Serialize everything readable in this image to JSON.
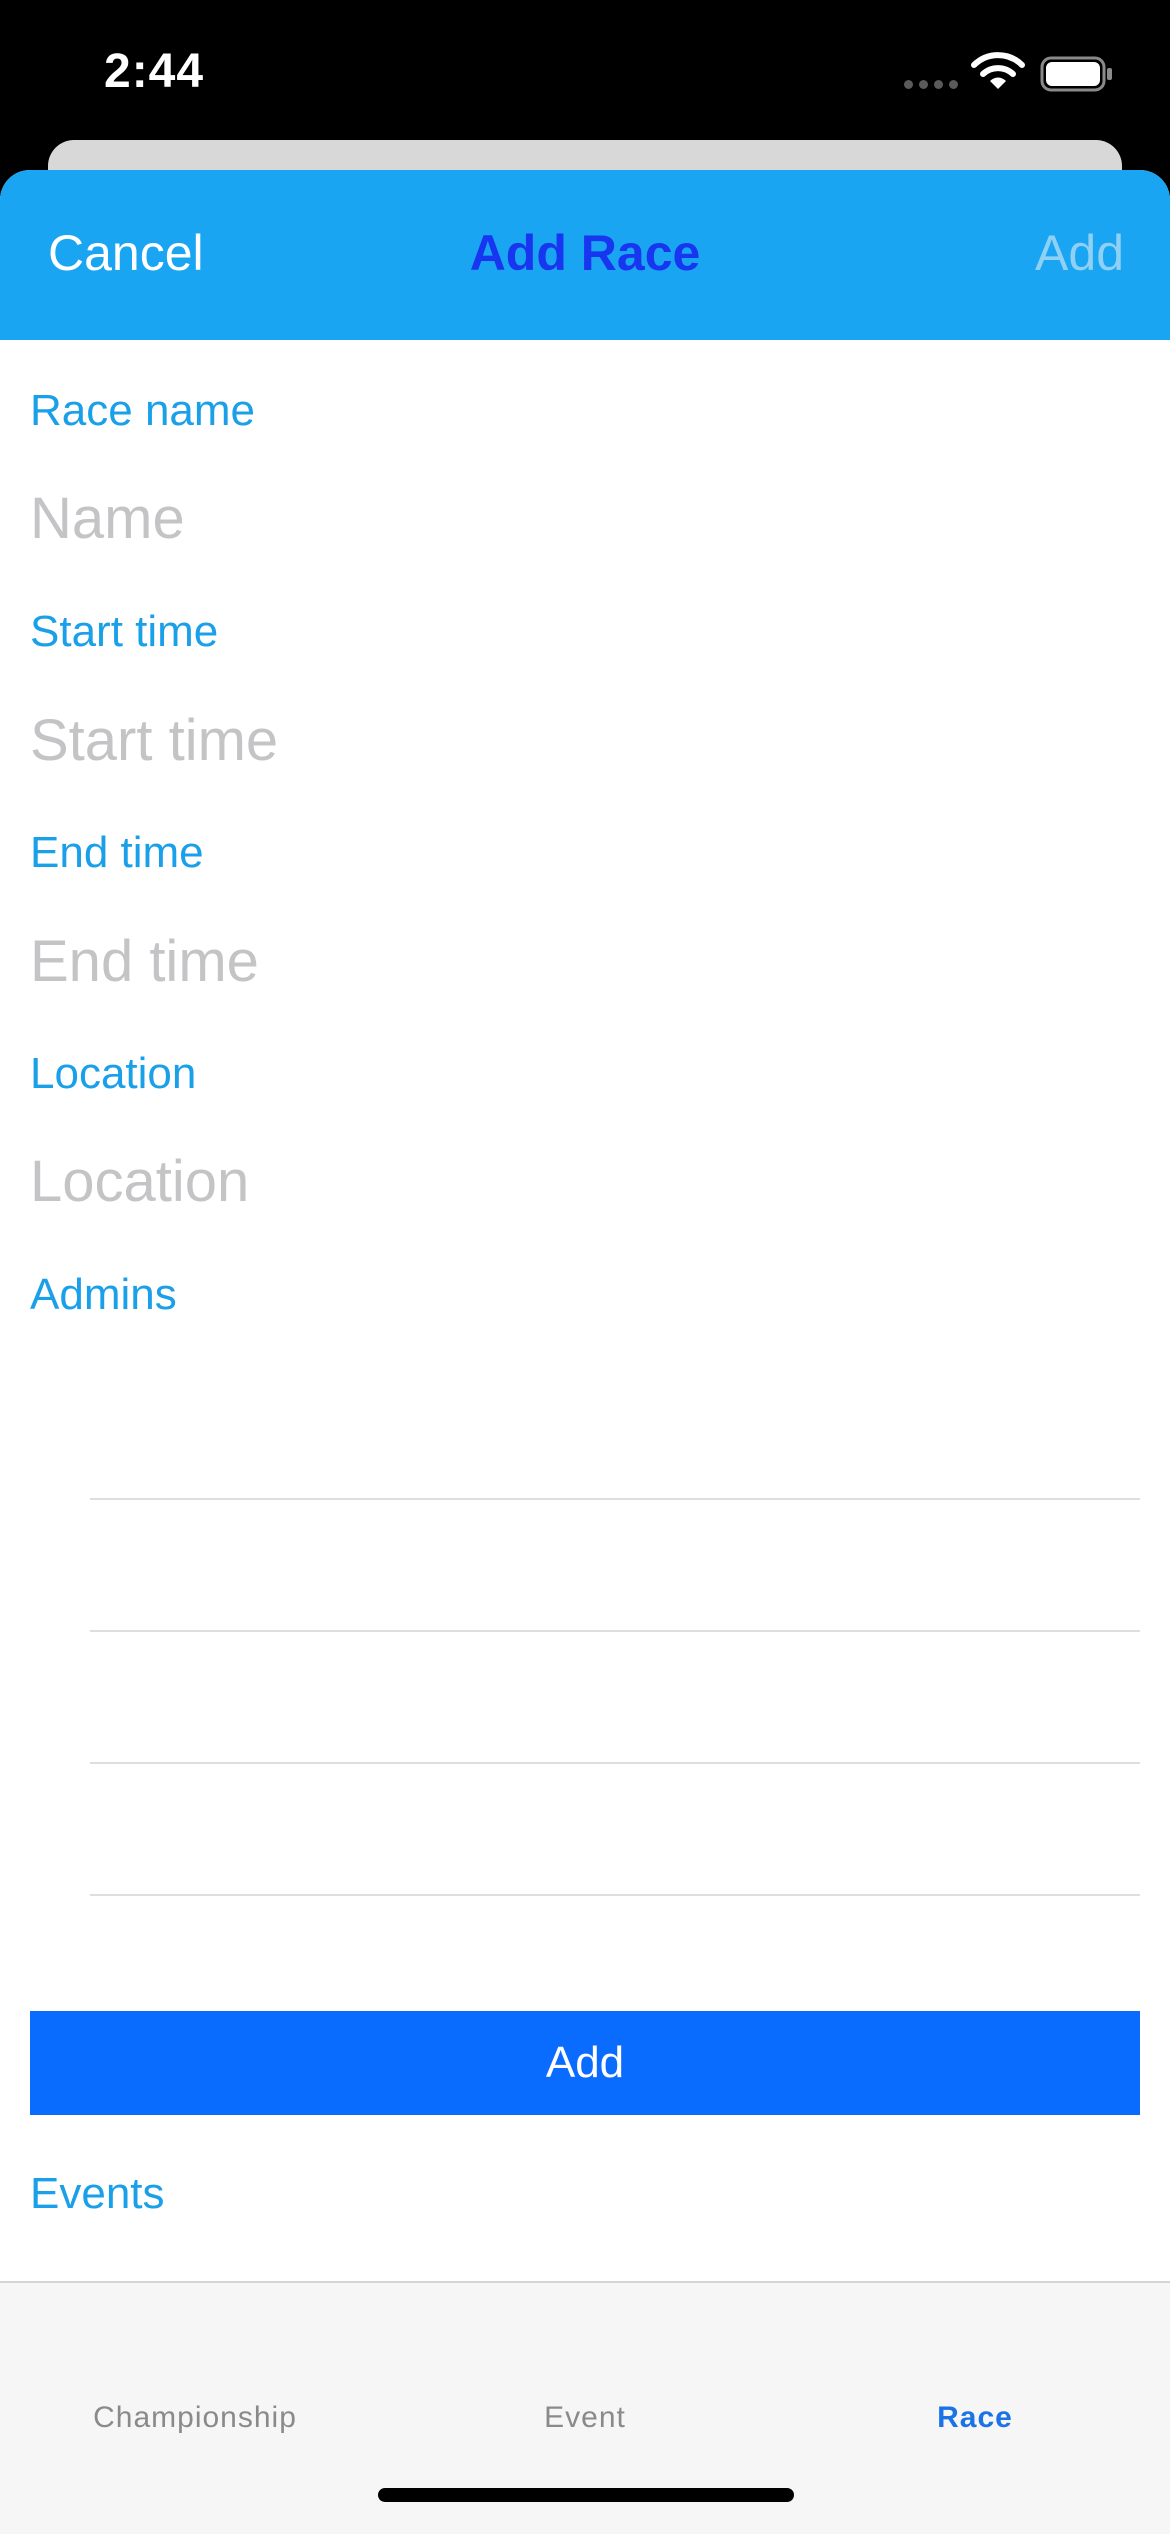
{
  "status_bar": {
    "time": "2:44"
  },
  "nav": {
    "cancel_label": "Cancel",
    "title": "Add Race",
    "add_label": "Add"
  },
  "form": {
    "race_name": {
      "label": "Race name",
      "placeholder": "Name",
      "value": ""
    },
    "start_time": {
      "label": "Start time",
      "placeholder": "Start time",
      "value": ""
    },
    "end_time": {
      "label": "End time",
      "placeholder": "End time",
      "value": ""
    },
    "location": {
      "label": "Location",
      "placeholder": "Location",
      "value": ""
    },
    "admins": {
      "label": "Admins",
      "rows": [
        "",
        "",
        "",
        ""
      ]
    },
    "add_admin_button_label": "Add",
    "events_label": "Events"
  },
  "tab_bar": {
    "tabs": [
      {
        "label": "Championship",
        "active": false
      },
      {
        "label": "Event",
        "active": false
      },
      {
        "label": "Race",
        "active": true
      }
    ]
  },
  "colors": {
    "nav_background": "#1aa5f2",
    "nav_title": "#1836ef",
    "label": "#1aa0e8",
    "primary_button": "#0a6bff",
    "active_tab": "#1a74e6"
  }
}
